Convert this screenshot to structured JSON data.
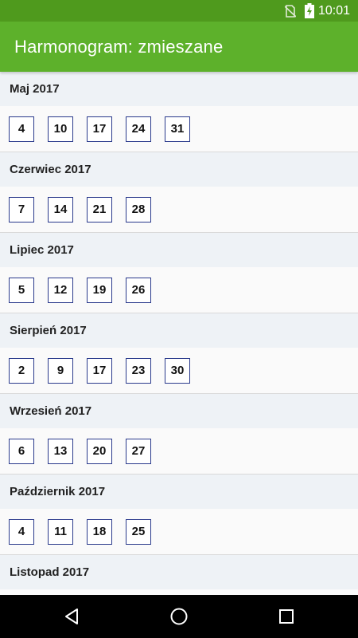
{
  "status_bar": {
    "time": "10:01",
    "icons": [
      "no-sim-icon",
      "battery-charging-icon"
    ]
  },
  "app_bar": {
    "title": "Harmonogram: zmieszane"
  },
  "months": [
    {
      "label": "Maj 2017",
      "days": [
        "4",
        "10",
        "17",
        "24",
        "31"
      ]
    },
    {
      "label": "Czerwiec 2017",
      "days": [
        "7",
        "14",
        "21",
        "28"
      ]
    },
    {
      "label": "Lipiec 2017",
      "days": [
        "5",
        "12",
        "19",
        "26"
      ]
    },
    {
      "label": "Sierpień 2017",
      "days": [
        "2",
        "9",
        "17",
        "23",
        "30"
      ]
    },
    {
      "label": "Wrzesień 2017",
      "days": [
        "6",
        "13",
        "20",
        "27"
      ]
    },
    {
      "label": "Październik 2017",
      "days": [
        "4",
        "11",
        "18",
        "25"
      ]
    },
    {
      "label": "Listopad 2017",
      "days": []
    }
  ],
  "nav_bar": {
    "icons": [
      "back-icon",
      "home-icon",
      "recents-icon"
    ]
  },
  "colors": {
    "status_bar": "#4f9a1d",
    "app_bar": "#5db12b",
    "month_header_bg": "#eef2f6",
    "day_border": "#2a3a8c"
  }
}
